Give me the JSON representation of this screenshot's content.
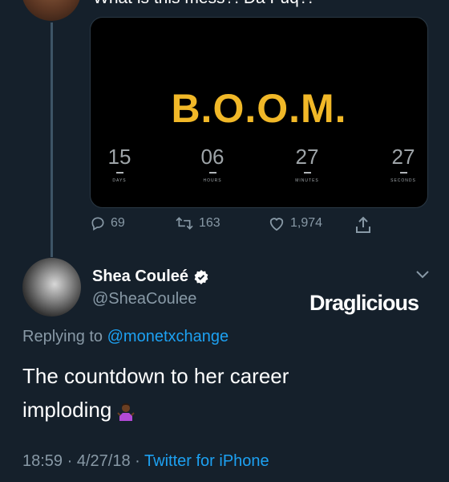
{
  "previous_tweet": {
    "text": "What is this mess?! Da Fuq?!"
  },
  "media": {
    "headline": "B.O.O.M.",
    "countdown": [
      {
        "value": "15",
        "label": "DAYS"
      },
      {
        "value": "06",
        "label": "HOURS"
      },
      {
        "value": "27",
        "label": "MINUTES"
      },
      {
        "value": "27",
        "label": "SECONDS"
      }
    ],
    "accent_color": "#f1b828"
  },
  "actions": {
    "replies": "69",
    "retweets": "163",
    "likes": "1,974"
  },
  "tweet": {
    "display_name": "Shea Couleé",
    "handle": "@SheaCoulee",
    "replying_prefix": "Replying to",
    "replying_to": "@monetxchange",
    "text": "The countdown to her career imploding",
    "emoji": "person-shrugging",
    "time": "18:59",
    "date": "4/27/18",
    "separator": "·",
    "source": "Twitter for iPhone"
  },
  "watermark": {
    "text": "Draglicious"
  },
  "colors": {
    "background": "#15202b",
    "link": "#1da1f2",
    "muted": "#8899a6"
  }
}
